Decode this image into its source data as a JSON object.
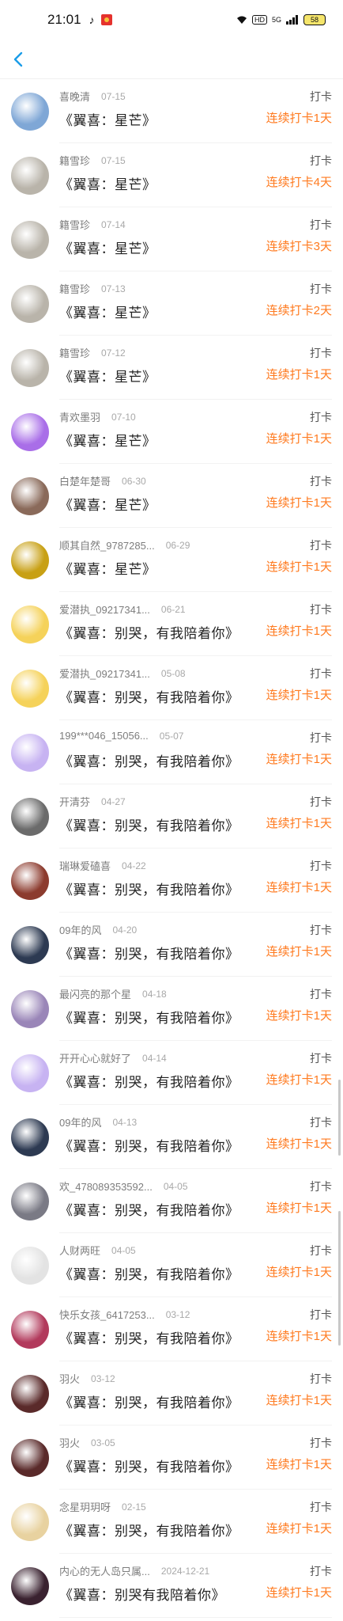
{
  "status_bar": {
    "time": "21:01",
    "hd_label": "HD",
    "network": "5G",
    "battery": "58"
  },
  "rows": [
    {
      "name": "喜晚清",
      "date": "07-15",
      "title": "《翼喜：星芒》",
      "action": "打卡",
      "streak": "连续打卡1天",
      "avatar_color": "#7fa7d6"
    },
    {
      "name": "籍雪珍",
      "date": "07-15",
      "title": "《翼喜：星芒》",
      "action": "打卡",
      "streak": "连续打卡4天",
      "avatar_color": "#b9b4aa"
    },
    {
      "name": "籍雪珍",
      "date": "07-14",
      "title": "《翼喜：星芒》",
      "action": "打卡",
      "streak": "连续打卡3天",
      "avatar_color": "#b9b4aa"
    },
    {
      "name": "籍雪珍",
      "date": "07-13",
      "title": "《翼喜：星芒》",
      "action": "打卡",
      "streak": "连续打卡2天",
      "avatar_color": "#b9b4aa"
    },
    {
      "name": "籍雪珍",
      "date": "07-12",
      "title": "《翼喜：星芒》",
      "action": "打卡",
      "streak": "连续打卡1天",
      "avatar_color": "#b9b4aa"
    },
    {
      "name": "青欢墨羽",
      "date": "07-10",
      "title": "《翼喜：星芒》",
      "action": "打卡",
      "streak": "连续打卡1天",
      "avatar_color": "#a96ee8"
    },
    {
      "name": "白楚年楚哥",
      "date": "06-30",
      "title": "《翼喜：星芒》",
      "action": "打卡",
      "streak": "连续打卡1天",
      "avatar_color": "#8a6a5a"
    },
    {
      "name": "顺其自然_9787285...",
      "date": "06-29",
      "title": "《翼喜：星芒》",
      "action": "打卡",
      "streak": "连续打卡1天",
      "avatar_color": "#c8a014"
    },
    {
      "name": "爱潜执_09217341...",
      "date": "06-21",
      "title": "《翼喜：别哭，有我陪着你》",
      "action": "打卡",
      "streak": "连续打卡1天",
      "avatar_color": "#f5d25a"
    },
    {
      "name": "爱潜执_09217341...",
      "date": "05-08",
      "title": "《翼喜：别哭，有我陪着你》",
      "action": "打卡",
      "streak": "连续打卡1天",
      "avatar_color": "#f5d25a"
    },
    {
      "name": "199***046_15056...",
      "date": "05-07",
      "title": "《翼喜：别哭，有我陪着你》",
      "action": "打卡",
      "streak": "连续打卡1天",
      "avatar_color": "#c7b3f2"
    },
    {
      "name": "开清芬",
      "date": "04-27",
      "title": "《翼喜：别哭，有我陪着你》",
      "action": "打卡",
      "streak": "连续打卡1天",
      "avatar_color": "#6b6b6b"
    },
    {
      "name": "瑞琳爱磕喜",
      "date": "04-22",
      "title": "《翼喜：别哭，有我陪着你》",
      "action": "打卡",
      "streak": "连续打卡1天",
      "avatar_color": "#8c3b2e"
    },
    {
      "name": "09年的风",
      "date": "04-20",
      "title": "《翼喜：别哭，有我陪着你》",
      "action": "打卡",
      "streak": "连续打卡1天",
      "avatar_color": "#2d3a52"
    },
    {
      "name": "最闪亮的那个星",
      "date": "04-18",
      "title": "《翼喜：别哭，有我陪着你》",
      "action": "打卡",
      "streak": "连续打卡1天",
      "avatar_color": "#9a86b8"
    },
    {
      "name": "开开心心就好了",
      "date": "04-14",
      "title": "《翼喜：别哭，有我陪着你》",
      "action": "打卡",
      "streak": "连续打卡1天",
      "avatar_color": "#c7b3f2"
    },
    {
      "name": "09年的风",
      "date": "04-13",
      "title": "《翼喜：别哭，有我陪着你》",
      "action": "打卡",
      "streak": "连续打卡1天",
      "avatar_color": "#2d3a52"
    },
    {
      "name": "欢_478089353592...",
      "date": "04-05",
      "title": "《翼喜：别哭，有我陪着你》",
      "action": "打卡",
      "streak": "连续打卡1天",
      "avatar_color": "#7a7a85"
    },
    {
      "name": "人财两旺",
      "date": "04-05",
      "title": "《翼喜：别哭，有我陪着你》",
      "action": "打卡",
      "streak": "连续打卡1天",
      "avatar_color": "#e3e3e3"
    },
    {
      "name": "快乐女孩_6417253...",
      "date": "03-12",
      "title": "《翼喜：别哭，有我陪着你》",
      "action": "打卡",
      "streak": "连续打卡1天",
      "avatar_color": "#b23a5c"
    },
    {
      "name": "羽火",
      "date": "03-12",
      "title": "《翼喜：别哭，有我陪着你》",
      "action": "打卡",
      "streak": "连续打卡1天",
      "avatar_color": "#5a2a2a"
    },
    {
      "name": "羽火",
      "date": "03-05",
      "title": "《翼喜：别哭，有我陪着你》",
      "action": "打卡",
      "streak": "连续打卡1天",
      "avatar_color": "#5a2a2a"
    },
    {
      "name": "念星玥玥呀",
      "date": "02-15",
      "title": "《翼喜：别哭，有我陪着你》",
      "action": "打卡",
      "streak": "连续打卡1天",
      "avatar_color": "#e8d2a0"
    },
    {
      "name": "内心的无人岛只属...",
      "date": "2024-12-21",
      "title": "《翼喜：别哭有我陪着你》",
      "action": "打卡",
      "streak": "连续打卡1天",
      "avatar_color": "#3a2230"
    }
  ],
  "colors": {
    "accent": "#ff7a1f",
    "back": "#1a9ce8"
  }
}
